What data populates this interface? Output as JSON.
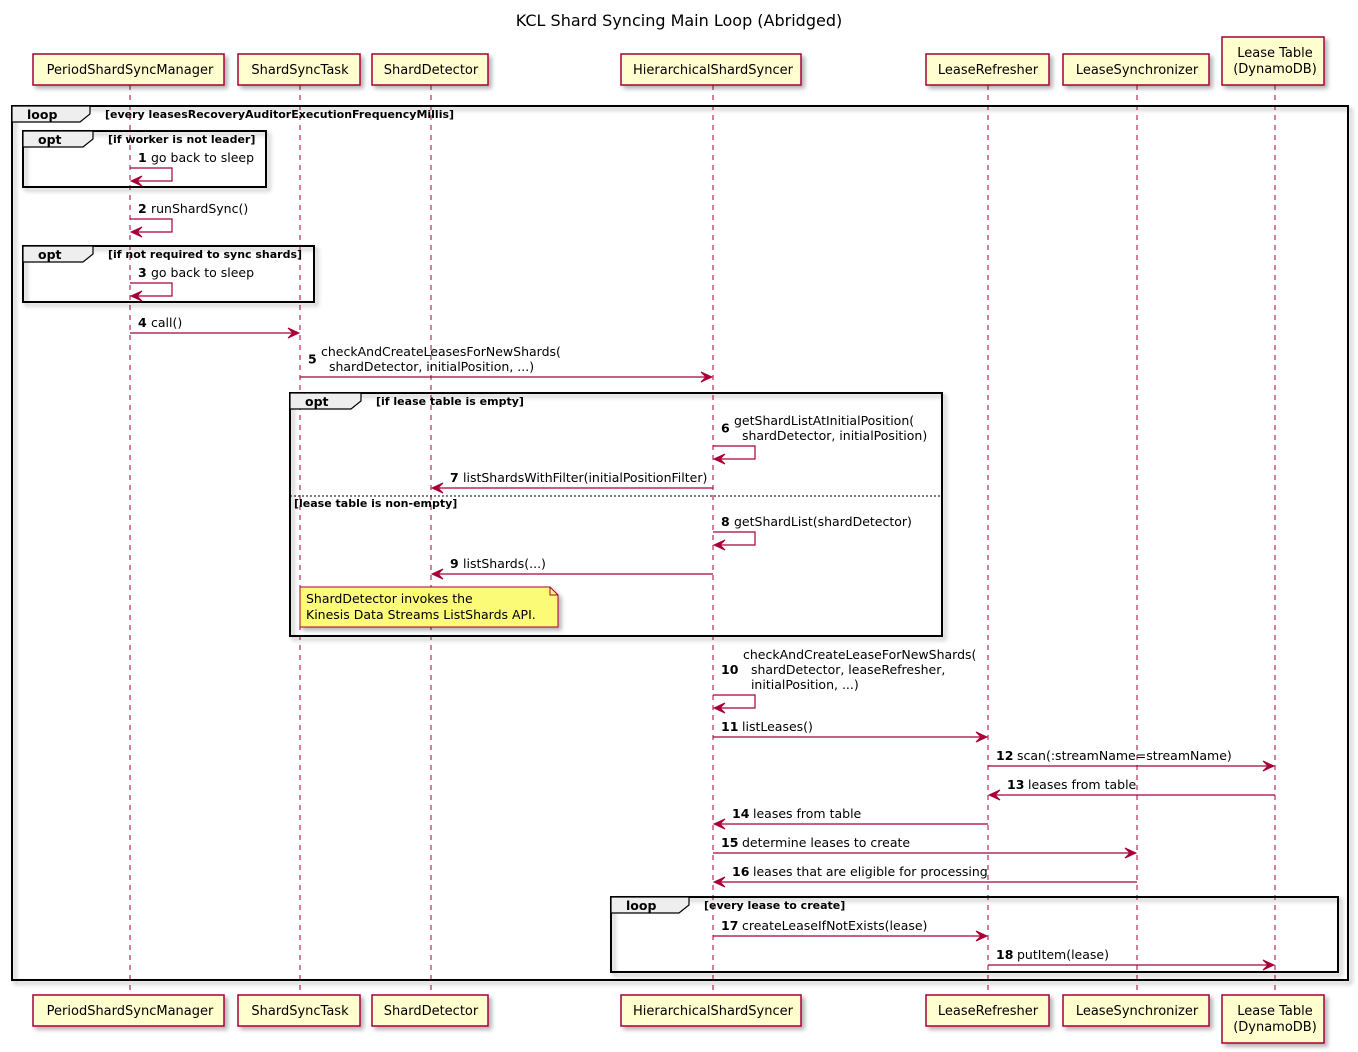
{
  "diagram": {
    "title": "KCL Shard Syncing Main Loop (Abridged)",
    "colors": {
      "participant_fill": "#FEFECE",
      "participant_border": "#A80036",
      "arrow": "#A80036",
      "lifeline": "#A80036",
      "frame_border": "#000000",
      "frame_tab_fill": "#EEEEEE",
      "note_fill": "#FBFB77",
      "note_border": "#A80036"
    },
    "participants": [
      {
        "id": "psm",
        "lines": [
          "PeriodShardSyncManager"
        ]
      },
      {
        "id": "sst",
        "lines": [
          "ShardSyncTask"
        ]
      },
      {
        "id": "sd",
        "lines": [
          "ShardDetector"
        ]
      },
      {
        "id": "hss",
        "lines": [
          "HierarchicalShardSyncer"
        ]
      },
      {
        "id": "lr",
        "lines": [
          "LeaseRefresher"
        ]
      },
      {
        "id": "ls",
        "lines": [
          "LeaseSynchronizer"
        ]
      },
      {
        "id": "lt",
        "lines": [
          "Lease Table",
          "(DynamoDB)"
        ]
      }
    ],
    "messages": [
      {
        "n": "1",
        "from": "psm",
        "to": "psm",
        "lines": [
          "go back to sleep"
        ]
      },
      {
        "n": "2",
        "from": "psm",
        "to": "psm",
        "lines": [
          "runShardSync()"
        ]
      },
      {
        "n": "3",
        "from": "psm",
        "to": "psm",
        "lines": [
          "go back to sleep"
        ]
      },
      {
        "n": "4",
        "from": "psm",
        "to": "sst",
        "lines": [
          "call()"
        ]
      },
      {
        "n": "5",
        "from": "sst",
        "to": "hss",
        "lines": [
          "checkAndCreateLeasesForNewShards(",
          "  shardDetector, initialPosition, ...)"
        ]
      },
      {
        "n": "6",
        "from": "hss",
        "to": "hss",
        "lines": [
          "getShardListAtInitialPosition(",
          "  shardDetector, initialPosition)"
        ]
      },
      {
        "n": "7",
        "from": "hss",
        "to": "sd",
        "lines": [
          "listShardsWithFilter(initialPositionFilter)"
        ]
      },
      {
        "n": "8",
        "from": "hss",
        "to": "hss",
        "lines": [
          "getShardList(shardDetector)"
        ]
      },
      {
        "n": "9",
        "from": "hss",
        "to": "sd",
        "lines": [
          "listShards(...)"
        ]
      },
      {
        "n": "10",
        "from": "hss",
        "to": "hss",
        "lines": [
          "checkAndCreateLeaseForNewShards(",
          "  shardDetector, leaseRefresher,",
          "  initialPosition, ...)"
        ]
      },
      {
        "n": "11",
        "from": "hss",
        "to": "lr",
        "lines": [
          "listLeases()"
        ]
      },
      {
        "n": "12",
        "from": "lr",
        "to": "lt",
        "lines": [
          "scan(:streamName=streamName)"
        ]
      },
      {
        "n": "13",
        "from": "lt",
        "to": "lr",
        "lines": [
          "leases from table"
        ]
      },
      {
        "n": "14",
        "from": "lr",
        "to": "hss",
        "lines": [
          "leases from table"
        ]
      },
      {
        "n": "15",
        "from": "hss",
        "to": "ls",
        "lines": [
          "determine leases to create"
        ]
      },
      {
        "n": "16",
        "from": "ls",
        "to": "hss",
        "lines": [
          "leases that are eligible for processing"
        ]
      },
      {
        "n": "17",
        "from": "hss",
        "to": "lr",
        "lines": [
          "createLeaseIfNotExists(lease)"
        ]
      },
      {
        "n": "18",
        "from": "lr",
        "to": "lt",
        "lines": [
          "putItem(lease)"
        ]
      }
    ],
    "frames": [
      {
        "id": "outer-loop",
        "kind": "loop",
        "condition": "[every leasesRecoveryAuditorExecutionFrequencyMillis]"
      },
      {
        "id": "opt-not-leader",
        "kind": "opt",
        "condition": "[if worker is not leader]"
      },
      {
        "id": "opt-no-sync",
        "kind": "opt",
        "condition": "[if not required to sync shards]"
      },
      {
        "id": "opt-lease-table",
        "kind": "opt",
        "condition": "[if lease table is empty]",
        "else_condition": "[lease table is non-empty]"
      },
      {
        "id": "inner-loop",
        "kind": "loop",
        "condition": "[every lease to create]"
      }
    ],
    "notes": [
      {
        "id": "shard-detector-note",
        "lines": [
          "ShardDetector invokes the",
          "Kinesis Data Streams ListShards API."
        ]
      }
    ]
  }
}
